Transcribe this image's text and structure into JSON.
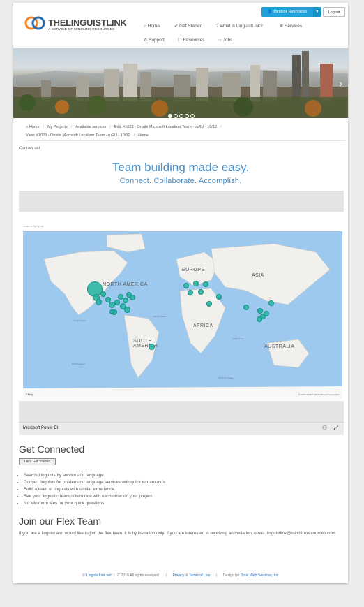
{
  "header": {
    "logo": {
      "brand": "THELINGUISTLINK",
      "tagline": "A SERVICE OF MINDLINK RESOURCES"
    },
    "mindlink_button": "Mindlink Resources",
    "logout_button": "Logout",
    "nav": [
      {
        "icon": "home-icon",
        "glyph": "⌂",
        "label": "Home"
      },
      {
        "icon": "check-icon",
        "glyph": "✔",
        "label": "Get Started"
      },
      {
        "icon": "question-icon",
        "glyph": "?",
        "label": "What is LinguistLink?"
      },
      {
        "icon": "list-icon",
        "glyph": "≣",
        "label": "Services"
      },
      {
        "icon": "phone-icon",
        "glyph": "✆",
        "label": "Support"
      },
      {
        "icon": "book-icon",
        "glyph": "❐",
        "label": "Resources"
      },
      {
        "icon": "laptop-icon",
        "glyph": "▭",
        "label": "Jobs"
      }
    ]
  },
  "breadcrumb": [
    "Home",
    "My Projects",
    "Available services",
    "Edit: #1023 - Onsite Microsoft Localizer Team - ruRU - 10/12",
    "View: #1023 - Onsite Microsoft Localizer Team - ruRU - 10/12",
    "Home"
  ],
  "contact_link": "Contact us!",
  "tagline": {
    "title": "Team building made easy.",
    "subtitle": "Connect. Collaborate. Accomplish."
  },
  "powerbi": {
    "caption": "Count of zip by city",
    "map_labels": {
      "north_america": "NORTH AMERICA",
      "europe": "EUROPE",
      "asia": "ASIA",
      "africa": "AFRICA",
      "south_america": "SOUTH AMERICA",
      "australia": "AUSTRALIA",
      "pacific_n": "Pacific Ocean",
      "atlantic": "Atlantic Ocean",
      "indian": "Indian Ocean",
      "pacific_s": "Pacific Ocean",
      "southern": "Southern Ocean"
    },
    "bing": "Bing",
    "copyright": "© 2016 HERE © 2016 Microsoft Corporation",
    "footer_title": "Microsoft Power BI"
  },
  "get_connected": {
    "title": "Get Connected",
    "button": "Let's Get Started",
    "bullets": [
      "Search Linguists by service and language.",
      "Contact linguists for on-demand language services with quick turnarounds.",
      "Build a team of linguists with similar experience.",
      "See your linguistic team collaborate with each other on your project.",
      "No Minimum fees for your quick questions."
    ]
  },
  "flex_team": {
    "title": "Join our Flex Team",
    "text": "If you are a linguist and would like to join the flex team, it is by invitation only. If you are interested in receiving an invitation, email: linguistlink@mindlinkresources.com"
  },
  "footer": {
    "copyright_prefix": "© ",
    "site": "LinguistLink.net",
    "copyright_suffix": ", LLC 2016 All rights reserved.",
    "privacy": "Privacy",
    "amp": " & ",
    "terms": "Terms of Use",
    "design_prefix": "Design by: ",
    "designer": "Total Web Services, Inc"
  },
  "colors": {
    "accent": "#4a90c8",
    "button_blue": "#1ea1d8",
    "map_dot": "#1fb2a0",
    "ocean": "#9ec9ee"
  }
}
